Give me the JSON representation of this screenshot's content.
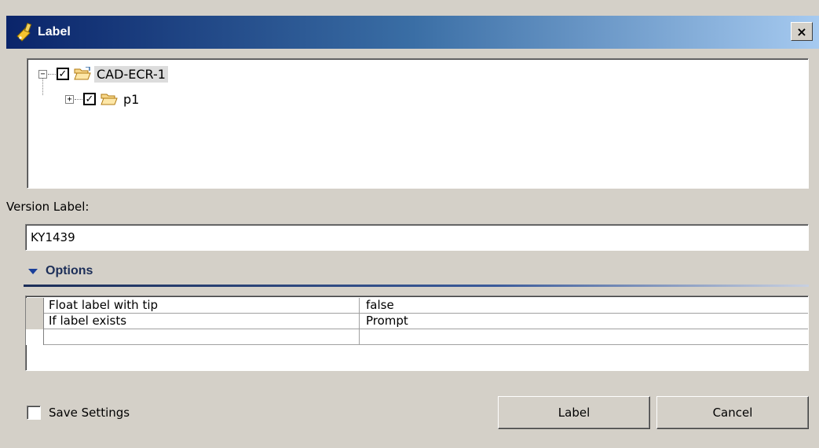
{
  "window": {
    "title": "Label",
    "close_glyph": "×"
  },
  "tree": {
    "root": {
      "label": "CAD-ECR-1",
      "checked": true,
      "expander": "−",
      "check_glyph": "✓"
    },
    "child": {
      "label": "p1",
      "checked": true,
      "expander": "+",
      "check_glyph": "✓"
    }
  },
  "version": {
    "label": "Version Label:",
    "value": "KY1439"
  },
  "options": {
    "title": "Options",
    "rows": [
      {
        "name": "Float label with tip",
        "value": "false"
      },
      {
        "name": "If label exists",
        "value": "Prompt"
      },
      {
        "name": "",
        "value": ""
      }
    ]
  },
  "save_settings": {
    "label": "Save Settings",
    "checked": false
  },
  "buttons": {
    "label": "Label",
    "cancel": "Cancel"
  },
  "colors": {
    "title_start": "#0a246a",
    "title_end": "#a6caf0",
    "dialog_bg": "#d4d0c8",
    "options_accent": "#1c2e58"
  },
  "icons": {
    "title": "label-tag-icon",
    "folder": "folder-open-icon"
  }
}
